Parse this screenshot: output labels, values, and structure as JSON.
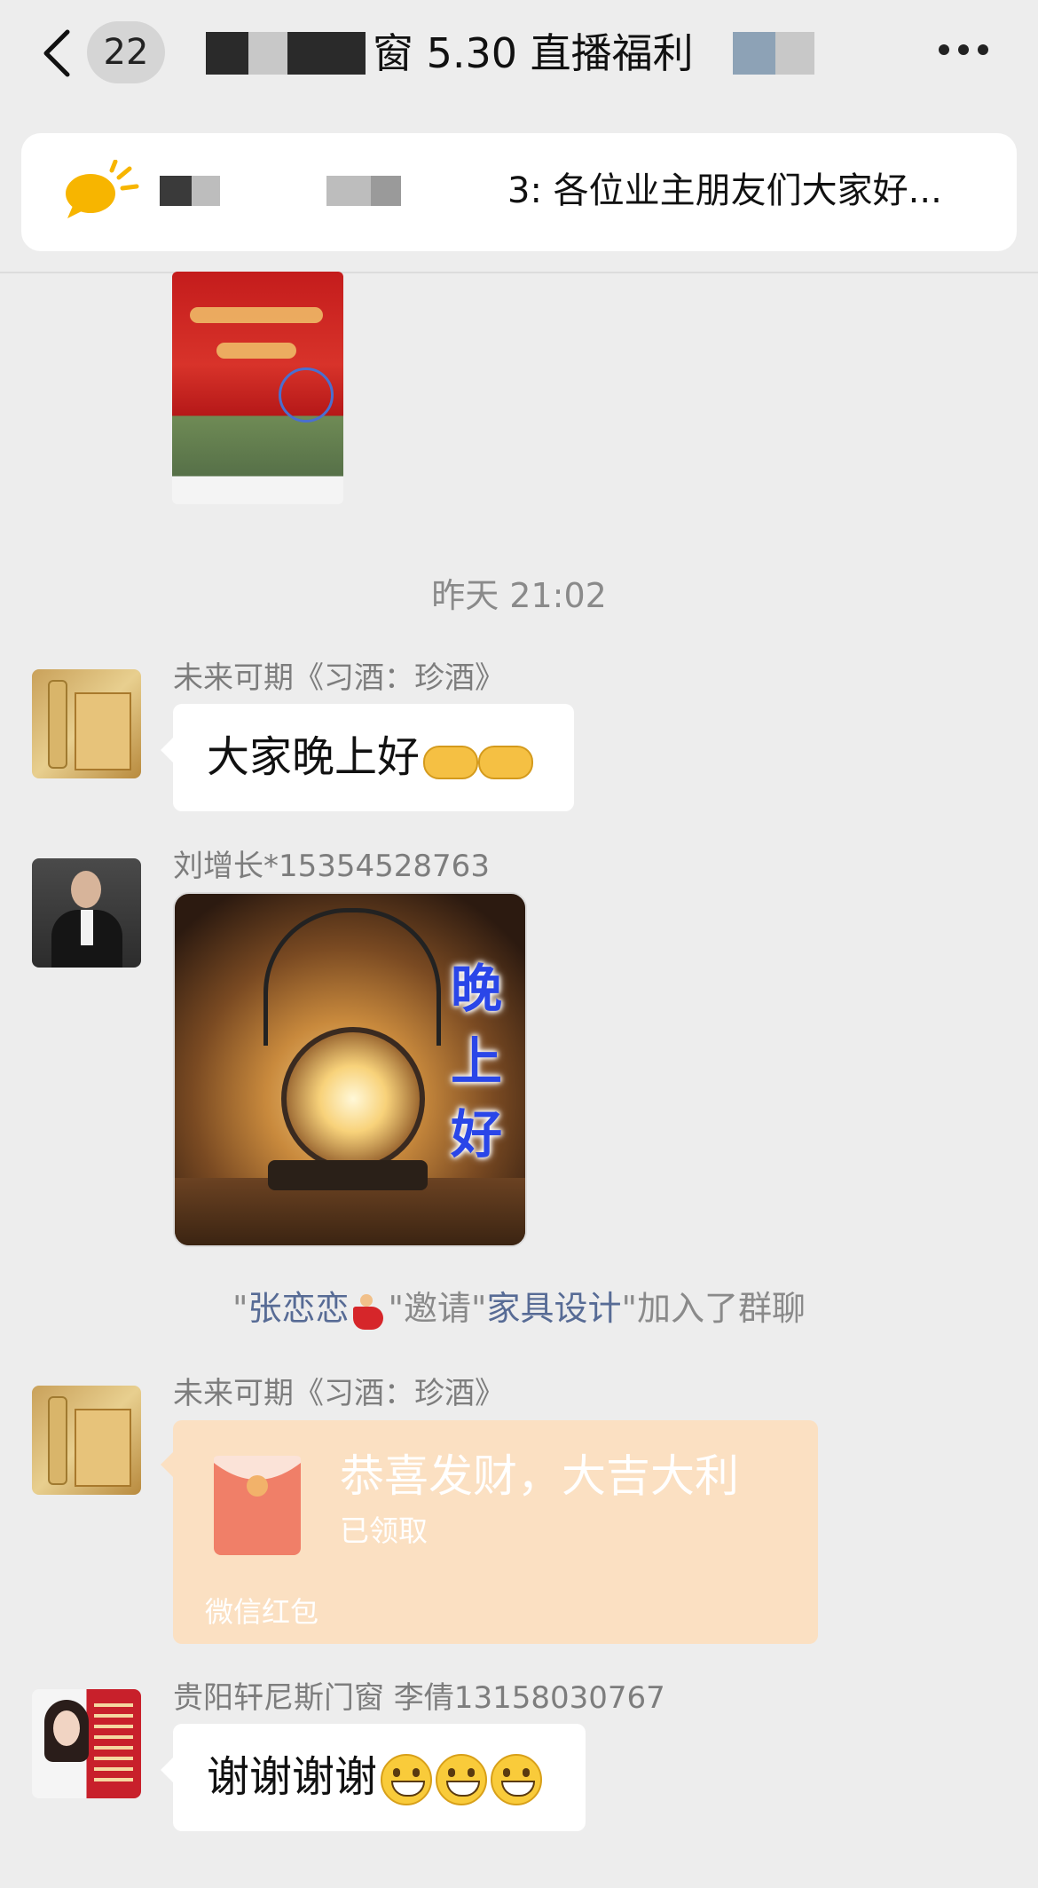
{
  "header": {
    "unread_count": "22",
    "title_visible": "窗 5.30 直播福利",
    "back_icon": "chevron-left-icon",
    "more_icon": "ellipsis-icon"
  },
  "announcement": {
    "icon": "speech-bubble-announcement-icon",
    "text": "3: 各位业主朋友们大家好..."
  },
  "timestamp": "昨天 21:02",
  "messages": [
    {
      "sender": "未来可期《习酒：珍酒》",
      "text": "大家晚上好",
      "emoji": [
        "handshake",
        "handshake"
      ]
    },
    {
      "sender": "刘增长*15354528763",
      "sticker_words": [
        "晚",
        "上",
        "好"
      ]
    },
    {
      "sender": "未来可期《习酒：珍酒》",
      "red_packet": {
        "title": "恭喜发财，大吉大利",
        "status": "已领取",
        "label": "微信红包"
      }
    },
    {
      "sender": "贵阳轩尼斯门窗 李倩13158030767",
      "text": "谢谢谢谢",
      "emoji": [
        "grinning",
        "grinning",
        "grinning"
      ]
    }
  ],
  "system_message": {
    "q1": "\"",
    "inviter": "张恋恋",
    "q2": "\"邀请\"",
    "invitee": "家具设计",
    "q3": "\"加入了群聊"
  },
  "colors": {
    "background": "#ededed",
    "link": "#576b95",
    "red_packet": "#fbe0c2",
    "sticker_text": "#2a46e8"
  }
}
